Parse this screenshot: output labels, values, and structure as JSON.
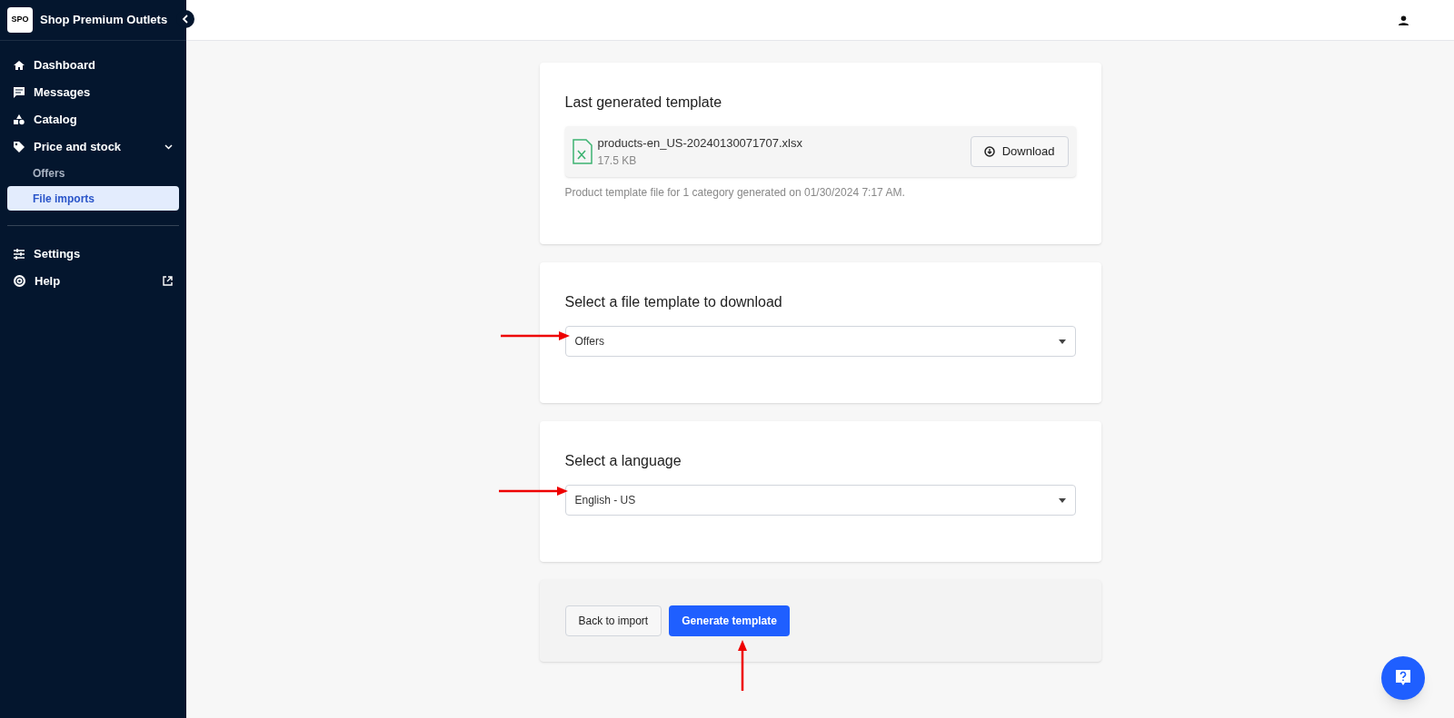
{
  "sidebar": {
    "brand": {
      "logo": "SPO",
      "name": "Shop Premium Outlets"
    },
    "items": [
      {
        "kind": "home",
        "label": "Dashboard",
        "selected": false
      },
      {
        "kind": "messages",
        "label": "Messages",
        "selected": false
      },
      {
        "kind": "catalog",
        "label": "Catalog",
        "selected": false
      },
      {
        "kind": "tag",
        "label": "Price and stock",
        "selected": false,
        "expanded": true,
        "children": [
          {
            "label": "Offers",
            "selected": false
          },
          {
            "label": "File imports",
            "selected": true
          }
        ]
      }
    ],
    "bottom_items": [
      {
        "kind": "settings",
        "label": "Settings",
        "external": false
      },
      {
        "kind": "help",
        "label": "Help",
        "external": true
      }
    ]
  },
  "last_template": {
    "title": "Last generated template",
    "file_name": "products-en_US-20240130071707.xlsx",
    "file_size": "17.5 KB",
    "download_button": "Download",
    "note": "Product template file for 1 category generated on 01/30/2024 7:17 AM."
  },
  "file_template": {
    "title": "Select a file template to download",
    "value": "Offers"
  },
  "language": {
    "title": "Select a language",
    "value": "English - US"
  },
  "actions": {
    "back_button": "Back to import",
    "generate_button": "Generate template"
  }
}
